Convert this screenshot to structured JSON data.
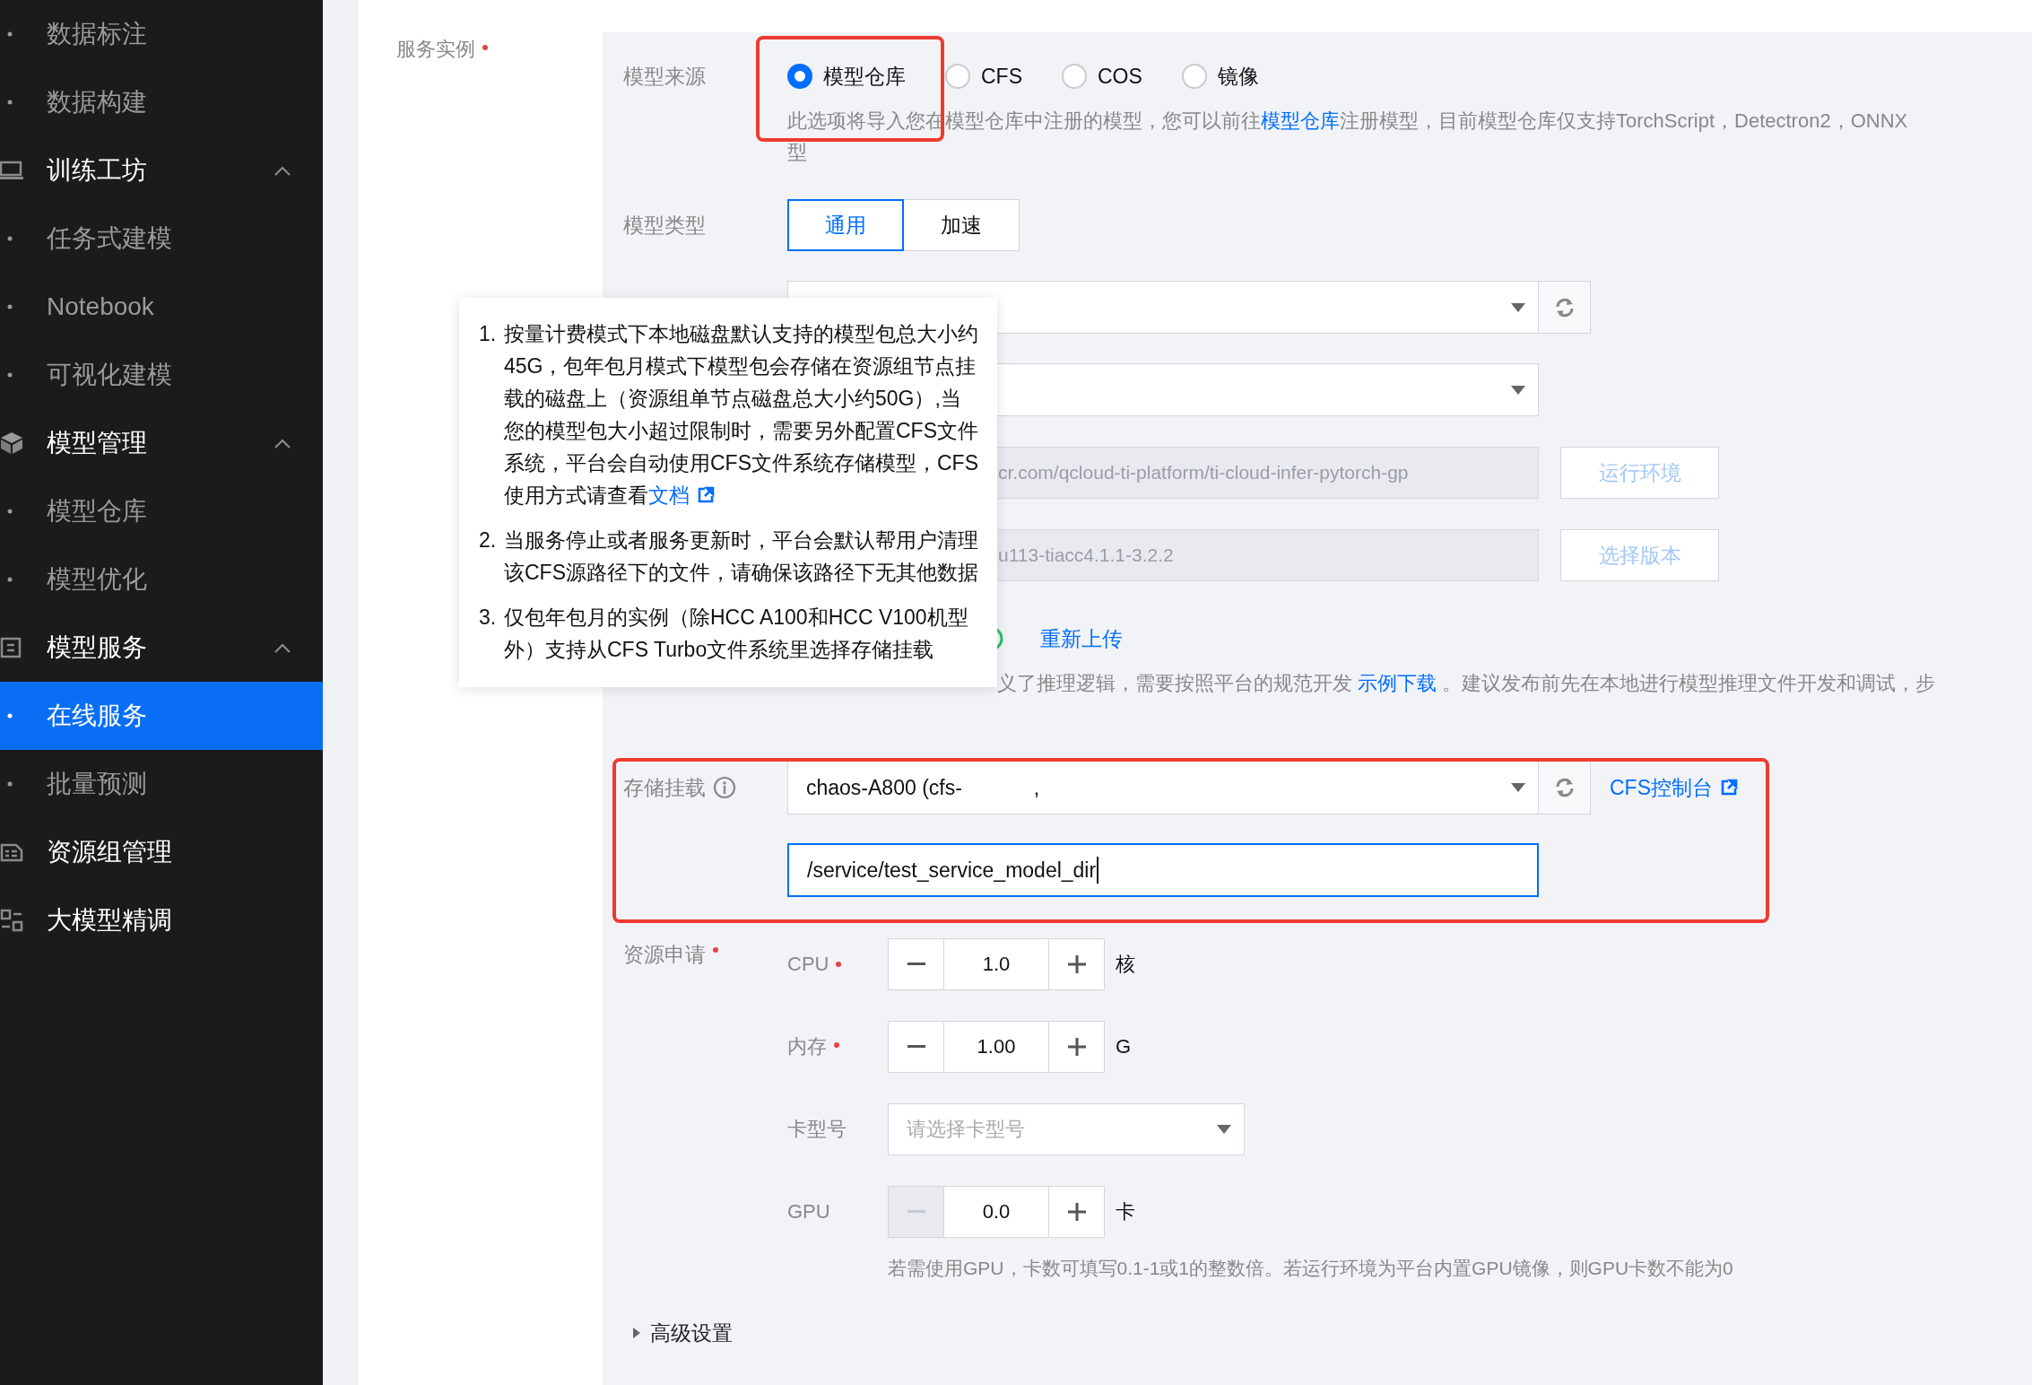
{
  "sidebar": {
    "items": [
      {
        "label": "数据标注",
        "kind": "sub",
        "selected": false
      },
      {
        "label": "数据构建",
        "kind": "sub",
        "selected": false
      },
      {
        "label": "训练工坊",
        "kind": "group",
        "expanded": true
      },
      {
        "label": "任务式建模",
        "kind": "sub",
        "selected": false
      },
      {
        "label": "Notebook",
        "kind": "sub",
        "selected": false
      },
      {
        "label": "可视化建模",
        "kind": "sub",
        "selected": false
      },
      {
        "label": "模型管理",
        "kind": "group",
        "expanded": true
      },
      {
        "label": "模型仓库",
        "kind": "sub",
        "selected": false
      },
      {
        "label": "模型优化",
        "kind": "sub",
        "selected": false
      },
      {
        "label": "模型服务",
        "kind": "group",
        "expanded": true
      },
      {
        "label": "在线服务",
        "kind": "sub",
        "selected": true
      },
      {
        "label": "批量预测",
        "kind": "sub",
        "selected": false
      },
      {
        "label": "资源组管理",
        "kind": "link"
      },
      {
        "label": "大模型精调",
        "kind": "link"
      }
    ]
  },
  "form": {
    "label": "服务实例",
    "required": true
  },
  "model_source": {
    "label": "模型来源",
    "options": [
      {
        "label": "模型仓库",
        "selected": true
      },
      {
        "label": "CFS",
        "selected": false
      },
      {
        "label": "COS",
        "selected": false
      },
      {
        "label": "镜像",
        "selected": false
      }
    ],
    "description": [
      "此选项将导入您在模型仓库中注册的模型，您可以前往",
      "注册模型，目前模型仓库仅支持TorchScript，Detectron2，ONNX",
      "型"
    ],
    "description_link": "模型仓库"
  },
  "model_type": {
    "label": "模型类型",
    "options": [
      {
        "label": "通用",
        "selected": true
      },
      {
        "label": "加速",
        "selected": false
      }
    ]
  },
  "image": {
    "value": "cr.com/qcloud-ti-platform/ti-cloud-infer-pytorch-gp",
    "button": "运行环境",
    "disabled": true
  },
  "version": {
    "value": "u113-tiacc4.1.1-3.2.2",
    "button": "选择版本",
    "disabled": true
  },
  "upload": {
    "link": "重新上传",
    "description_before": "义了推理逻辑，需要按照平台的规范开发",
    "description_link": "示例下载",
    "description_after": "。建议发布前先在本地进行模型推理文件开发和调试，步"
  },
  "storage": {
    "label": "存储挂载",
    "value": "chaos-A800 (cfs-",
    "value_tail": ",",
    "link": "CFS控制台",
    "path": "/service/test_service_model_dir"
  },
  "resources": {
    "label": "资源申请",
    "required": true,
    "rows": [
      {
        "kind": "stepper",
        "label": "CPU",
        "required": true,
        "value": "1.0",
        "unit": "核",
        "minus_disabled": false
      },
      {
        "kind": "stepper",
        "label": "内存",
        "required": true,
        "value": "1.00",
        "unit": "G",
        "minus_disabled": false
      },
      {
        "kind": "select",
        "label": "卡型号",
        "required": false,
        "placeholder": "请选择卡型号"
      },
      {
        "kind": "stepper",
        "label": "GPU",
        "required": false,
        "value": "0.0",
        "unit": "卡",
        "minus_disabled": true
      }
    ],
    "hint": "若需使用GPU，卡数可填写0.1-1或1的整数倍。若运行环境为平台内置GPU镜像，则GPU卡数不能为0"
  },
  "advanced": {
    "label": "高级设置",
    "expanded": false
  },
  "tooltip": {
    "items": [
      {
        "number": "1.",
        "text": "按量计费模式下本地磁盘默认支持的模型包总大小约45G，包年包月模式下模型包会存储在资源组节点挂载的磁盘上（资源组单节点磁盘总大小约50G）,当您的模型包大小超过限制时，需要另外配置CFS文件系统，平台会自动使用CFS文件系统存储模型，CFS使用方式请查看",
        "link": "文档"
      },
      {
        "number": "2.",
        "text": "当服务停止或者服务更新时，平台会默认帮用户清理该CFS源路径下的文件，请确保该路径下无其他数据"
      },
      {
        "number": "3.",
        "text": "仅包年包月的实例（除HCC A100和HCC V100机型外）支持从CFS Turbo文件系统里选择存储挂载"
      }
    ]
  }
}
